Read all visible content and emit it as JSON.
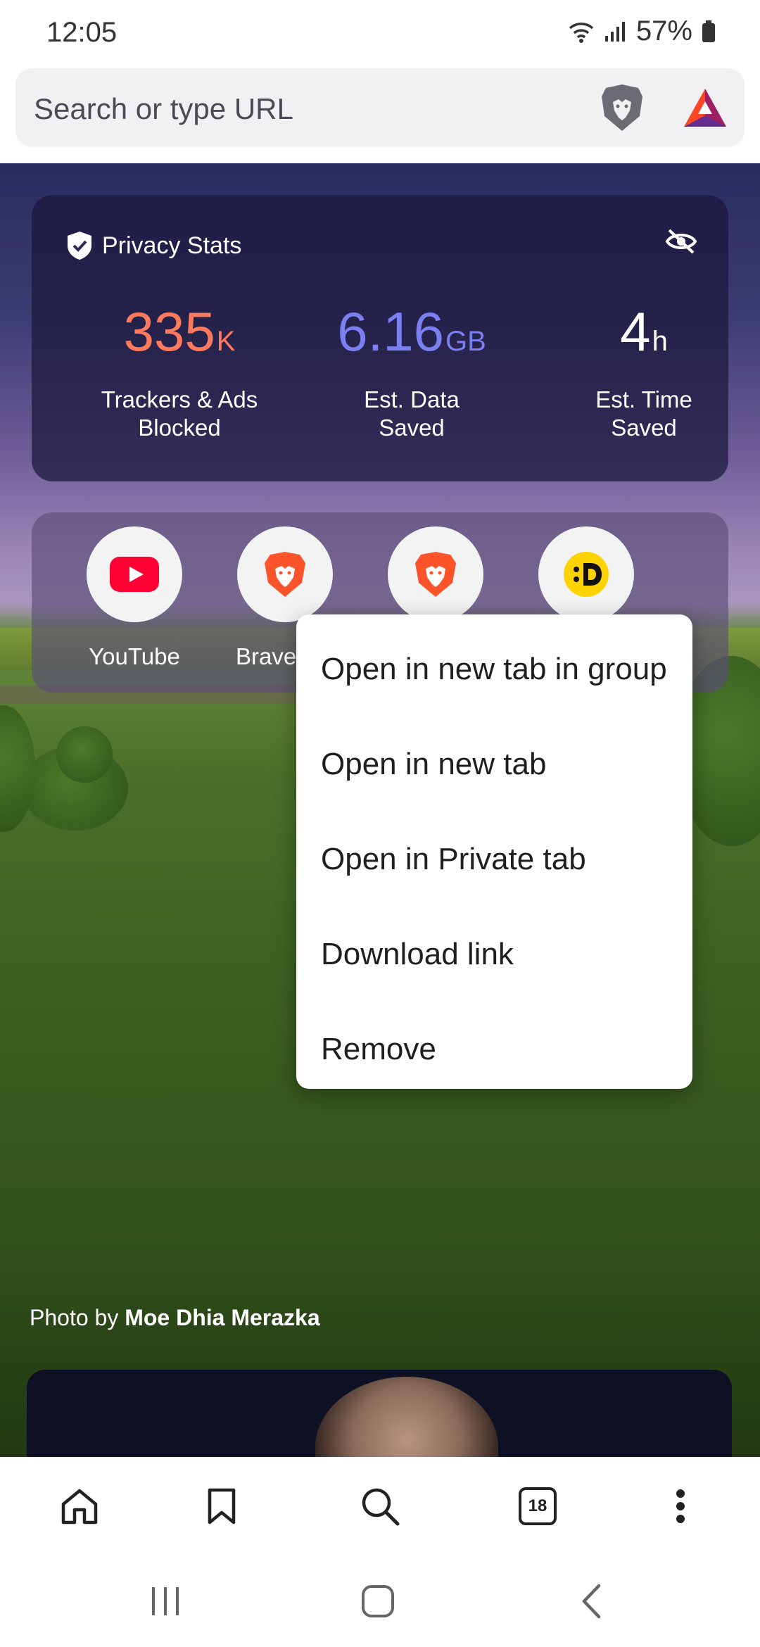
{
  "status_bar": {
    "time": "12:05",
    "battery": "57%"
  },
  "address_bar": {
    "placeholder": "Search or type URL"
  },
  "privacy_stats": {
    "title": "Privacy Stats",
    "stats": [
      {
        "value": "335",
        "unit": "K",
        "label": "Trackers & Ads\nBlocked",
        "color": "#ff7a5c"
      },
      {
        "value": "6.16",
        "unit": "GB",
        "label": "Est. Data\nSaved",
        "color": "#7b7ff0"
      },
      {
        "value": "4",
        "unit": "h",
        "label": "Est. Time\nSaved",
        "color": "#ffffff"
      }
    ]
  },
  "top_sites": [
    {
      "label": "YouTube",
      "icon": "youtube-icon"
    },
    {
      "label": "Brave H",
      "icon": "brave-lion-icon"
    },
    {
      "label": "",
      "icon": "brave-lion-icon"
    },
    {
      "label": "",
      "icon": "dlive-icon"
    }
  ],
  "context_menu": {
    "items": [
      "Open in new tab in group",
      "Open in new tab",
      "Open in Private tab",
      "Download link",
      "Remove"
    ]
  },
  "photo_credit": {
    "prefix": "Photo by ",
    "author": "Moe Dhia Merazka"
  },
  "toolbar": {
    "tab_count": "18"
  },
  "colors": {
    "brave_orange": "#fb542b",
    "youtube_red": "#ff0033",
    "accent_purple": "#7b7ff0"
  }
}
